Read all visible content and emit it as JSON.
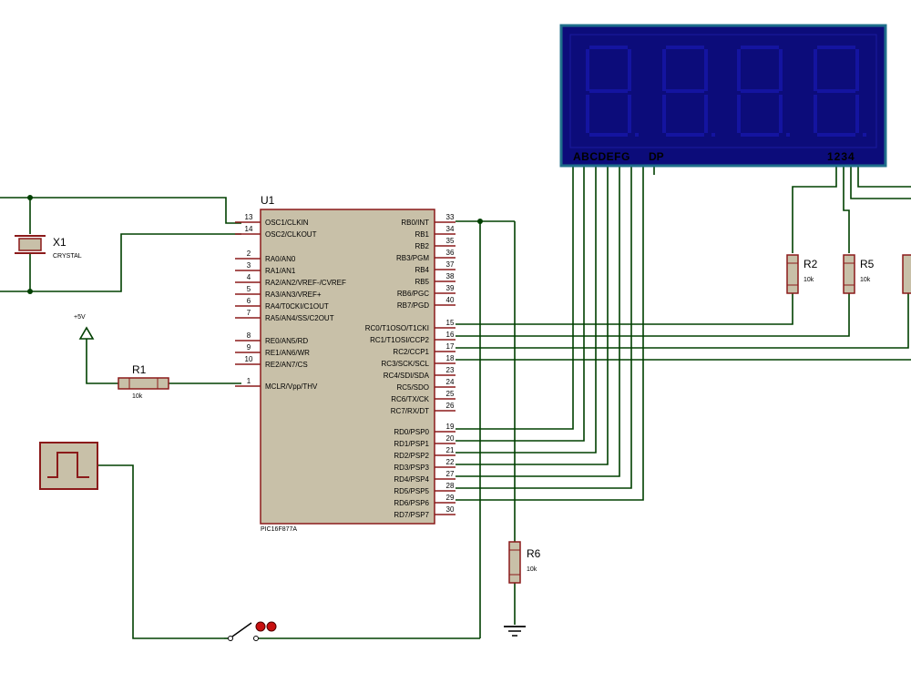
{
  "colors": {
    "wire": "#004000",
    "component_body": "#c8c0a8",
    "component_outline": "#8b1a1a",
    "display_frame": "#1f6f8b",
    "display_bg": "#0c0c7a",
    "segment_off": "#1414a0",
    "display_label": "#000000"
  },
  "u1": {
    "ref": "U1",
    "part": "PIC16F877A",
    "left_pins": [
      {
        "num": "13",
        "label": "OSC1/CLKIN"
      },
      {
        "num": "14",
        "label": "OSC2/CLKOUT"
      },
      {
        "num": "2",
        "label": "RA0/AN0"
      },
      {
        "num": "3",
        "label": "RA1/AN1"
      },
      {
        "num": "4",
        "label": "RA2/AN2/VREF-/CVREF"
      },
      {
        "num": "5",
        "label": "RA3/AN3/VREF+"
      },
      {
        "num": "6",
        "label": "RA4/T0CKI/C1OUT"
      },
      {
        "num": "7",
        "label": "RA5/AN4/SS/C2OUT"
      },
      {
        "num": "8",
        "label": "RE0/AN5/RD"
      },
      {
        "num": "9",
        "label": "RE1/AN6/WR"
      },
      {
        "num": "10",
        "label": "RE2/AN7/CS"
      },
      {
        "num": "1",
        "label": "MCLR/Vpp/THV"
      }
    ],
    "right_pins": [
      {
        "num": "33",
        "label": "RB0/INT"
      },
      {
        "num": "34",
        "label": "RB1"
      },
      {
        "num": "35",
        "label": "RB2"
      },
      {
        "num": "36",
        "label": "RB3/PGM"
      },
      {
        "num": "37",
        "label": "RB4"
      },
      {
        "num": "38",
        "label": "RB5"
      },
      {
        "num": "39",
        "label": "RB6/PGC"
      },
      {
        "num": "40",
        "label": "RB7/PGD"
      },
      {
        "num": "15",
        "label": "RC0/T1OSO/T1CKI"
      },
      {
        "num": "16",
        "label": "RC1/T1OSI/CCP2"
      },
      {
        "num": "17",
        "label": "RC2/CCP1"
      },
      {
        "num": "18",
        "label": "RC3/SCK/SCL"
      },
      {
        "num": "23",
        "label": "RC4/SDI/SDA"
      },
      {
        "num": "24",
        "label": "RC5/SDO"
      },
      {
        "num": "25",
        "label": "RC6/TX/CK"
      },
      {
        "num": "26",
        "label": "RC7/RX/DT"
      },
      {
        "num": "19",
        "label": "RD0/PSP0"
      },
      {
        "num": "20",
        "label": "RD1/PSP1"
      },
      {
        "num": "21",
        "label": "RD2/PSP2"
      },
      {
        "num": "22",
        "label": "RD3/PSP3"
      },
      {
        "num": "27",
        "label": "RD4/PSP4"
      },
      {
        "num": "28",
        "label": "RD5/PSP5"
      },
      {
        "num": "29",
        "label": "RD6/PSP6"
      },
      {
        "num": "30",
        "label": "RD7/PSP7"
      }
    ]
  },
  "x1": {
    "ref": "X1",
    "value": "CRYSTAL"
  },
  "r1": {
    "ref": "R1",
    "value": "10k"
  },
  "r2": {
    "ref": "R2",
    "value": "10k"
  },
  "r5": {
    "ref": "R5",
    "value": "10k"
  },
  "r6": {
    "ref": "R6",
    "value": "10k"
  },
  "power": {
    "label": "+5V"
  },
  "display": {
    "digit_count": 4,
    "segment_pins": "ABCDEFG",
    "dp_pin": "DP",
    "digit_pins": "1234"
  }
}
